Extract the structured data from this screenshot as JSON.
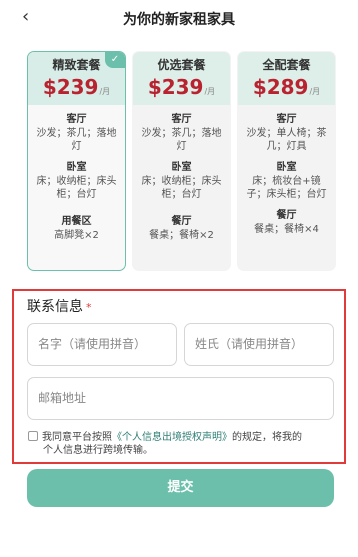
{
  "header": {
    "back_glyph": "‹",
    "title": "为你的新家租家具"
  },
  "plans": [
    {
      "name": "精致套餐",
      "price": "$239",
      "unit": "/月",
      "selected": true,
      "rooms": [
        {
          "name": "客厅",
          "items": "沙发；茶几；落地灯"
        },
        {
          "name": "卧室",
          "items": "床；收纳柜；床头柜；台灯"
        },
        {
          "name": "用餐区",
          "items": "高脚凳×2"
        }
      ]
    },
    {
      "name": "优选套餐",
      "price": "$239",
      "unit": "/月",
      "selected": false,
      "rooms": [
        {
          "name": "客厅",
          "items": "沙发；茶几；落地灯"
        },
        {
          "name": "卧室",
          "items": "床；收纳柜；床头柜；台灯"
        },
        {
          "name": "餐厅",
          "items": "餐桌；餐椅×2"
        }
      ]
    },
    {
      "name": "全配套餐",
      "price": "$289",
      "unit": "/月",
      "selected": false,
      "rooms": [
        {
          "name": "客厅",
          "items": "沙发；单人椅；茶几；灯具"
        },
        {
          "name": "卧室",
          "items": "床；梳妆台+镜子；床头柜；台灯"
        },
        {
          "name": "餐厅",
          "items": "餐桌；餐椅×4"
        }
      ]
    }
  ],
  "contact": {
    "title": "联系信息",
    "required_mark": "*",
    "first_name_placeholder": "名字（请使用拼音）",
    "last_name_placeholder": "姓氏（请使用拼音）",
    "email_placeholder": "邮箱地址",
    "consent_pre": "我同意平台按照",
    "consent_link": "《个人信息出境授权声明》",
    "consent_post": "的规定，将我的",
    "consent_line2": "个人信息进行跨境传输。"
  },
  "submit_label": "提交",
  "colors": {
    "accent": "#6bbfab",
    "price": "#b8232f",
    "highlight_border": "#e03a3a",
    "link": "#2f7f76"
  },
  "icons": {
    "back": "chevron-left-icon",
    "selected": "check-icon"
  }
}
